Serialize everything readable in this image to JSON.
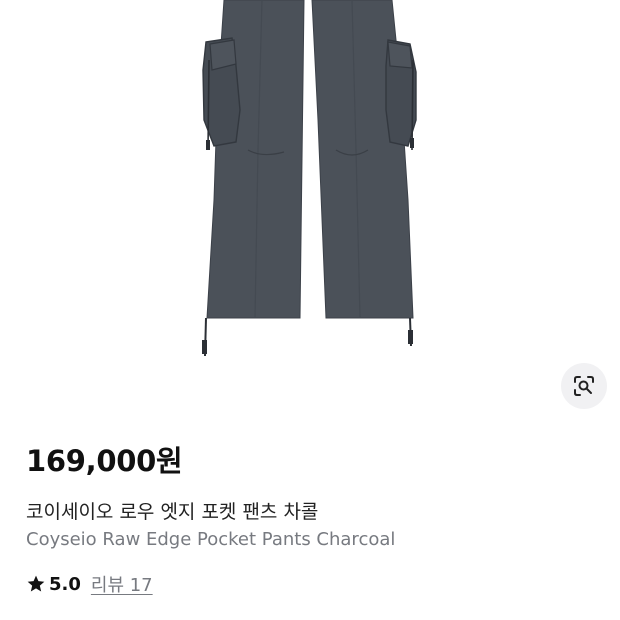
{
  "product": {
    "image_alt": "Charcoal cargo pants with side pockets and drawstring hems",
    "price": "169,000원",
    "name_ko": "코이세이오 로우 엣지 포켓 팬츠 차콜",
    "name_en": "Coyseio Raw Edge Pocket Pants Charcoal"
  },
  "rating": {
    "star_icon": "star-icon",
    "score": "5.0",
    "reviews": "리뷰 17"
  },
  "actions": {
    "lens_icon": "visual-search-icon"
  },
  "colors": {
    "pants": "#4a5058",
    "price_text": "#111111",
    "secondary_text": "#777a80",
    "lens_bg": "#f1f1f3"
  }
}
